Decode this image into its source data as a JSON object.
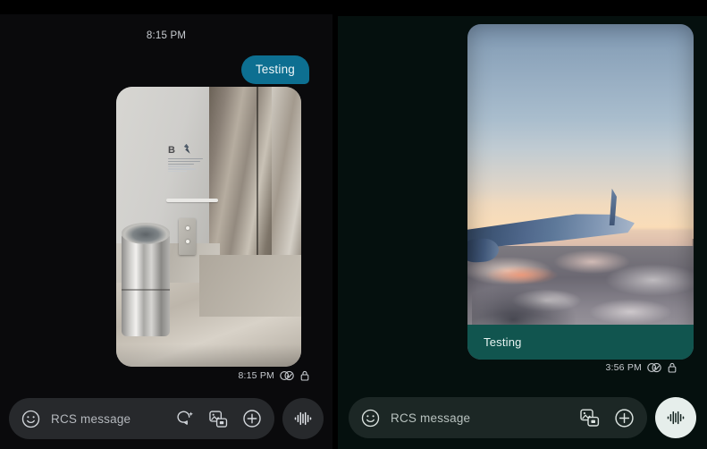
{
  "left_conversation": {
    "day_timestamp": "8:15 PM",
    "outgoing_text": "Testing",
    "attachment": {
      "name": "elevator-lobby-photo",
      "sign_letter": "B"
    },
    "status": {
      "time": "8:15 PM",
      "delivery_icon": "double-check-circle-icon",
      "encryption_icon": "lock-icon"
    },
    "composer": {
      "emoji_icon": "emoji-smiley-icon",
      "placeholder": "RCS message",
      "magic_compose_icon": "sparkle-chat-bubble-icon",
      "gallery_icon": "gallery-camera-icon",
      "plus_icon": "plus-circle-icon",
      "voice_icon": "audio-waveform-icon"
    },
    "colors": {
      "background": "#0a0a0c",
      "bubble": "#0d6f91",
      "pill": "#27292c"
    }
  },
  "right_conversation": {
    "caption_text": "Testing",
    "attachment": {
      "name": "airplane-wing-sunset-photo"
    },
    "status": {
      "time": "3:56 PM",
      "delivery_icon": "double-check-circle-icon",
      "encryption_icon": "lock-icon"
    },
    "composer": {
      "emoji_icon": "emoji-smiley-icon",
      "placeholder": "RCS message",
      "gallery_icon": "gallery-camera-icon",
      "plus_icon": "plus-circle-icon",
      "voice_icon": "audio-waveform-icon"
    },
    "colors": {
      "background": "#05100e",
      "bubble": "#11554f",
      "pill": "#1c2725"
    }
  }
}
